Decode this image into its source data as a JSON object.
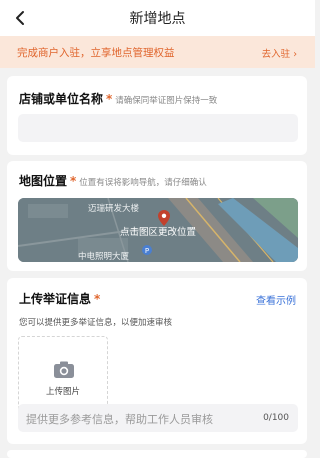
{
  "nav": {
    "title": "新增地点",
    "back_icon": "back-arrow-icon"
  },
  "banner": {
    "message": "完成商户入驻，立享地点管理权益",
    "link": "去入驻 ›"
  },
  "store_name": {
    "label": "店铺或单位名称",
    "required": "*",
    "hint": "请确保同举证图片保持一致",
    "value": ""
  },
  "location": {
    "label": "地图位置",
    "required": "*",
    "hint": "位置有误将影响导航，请仔细确认",
    "map_overlay": "点击图区更改位置",
    "poi1": "迈瑞研发大楼",
    "poi2": "中电照明大厦"
  },
  "evidence": {
    "label": "上传举证信息",
    "required": "*",
    "sample_link": "查看示例",
    "subtext": "您可以提供更多举证信息，以便加速审核",
    "upload_label": "上传图片",
    "placeholder": "提供更多参考信息，帮助工作人员审核",
    "counter": "0/100"
  },
  "colors": {
    "accent": "#e0662e",
    "link": "#3a72d8",
    "banner_bg": "#fbe7da"
  }
}
